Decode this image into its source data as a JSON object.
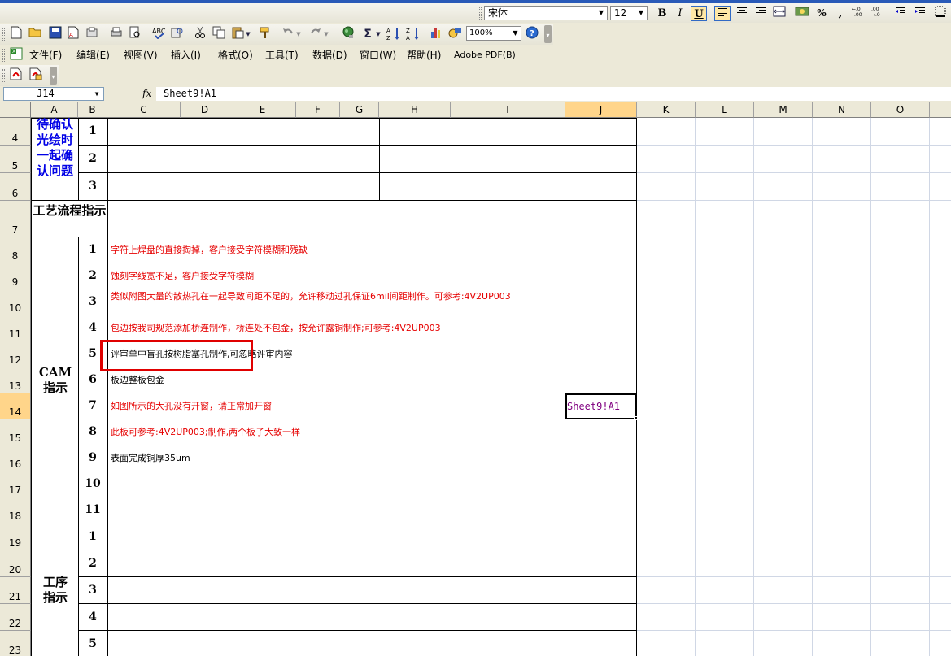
{
  "toolbar_format": {
    "font_name": "宋体",
    "font_size": "12",
    "bold_label": "B",
    "italic_label": "I",
    "underline_label": "U",
    "percent_label": "%",
    "comma_label": ","
  },
  "toolbar_standard": {
    "zoom": "100%"
  },
  "menu": {
    "items": [
      {
        "label": "文件(F)"
      },
      {
        "label": "编辑(E)"
      },
      {
        "label": "视图(V)"
      },
      {
        "label": "插入(I)"
      },
      {
        "label": "格式(O)"
      },
      {
        "label": "工具(T)"
      },
      {
        "label": "数据(D)"
      },
      {
        "label": "窗口(W)"
      },
      {
        "label": "帮助(H)"
      },
      {
        "label": "Adobe PDF(B)"
      }
    ]
  },
  "formula_bar": {
    "name_box": "J14",
    "fx_label": "fx",
    "formula": "Sheet9!A1"
  },
  "columns": [
    "A",
    "B",
    "C",
    "D",
    "E",
    "F",
    "G",
    "H",
    "I",
    "J",
    "K",
    "L",
    "M",
    "N",
    "O"
  ],
  "rows": [
    "4",
    "5",
    "6",
    "7",
    "8",
    "9",
    "10",
    "11",
    "12",
    "13",
    "14",
    "15",
    "16",
    "17",
    "18",
    "19",
    "20",
    "21",
    "22",
    "23"
  ],
  "sections": {
    "confirm": "待确认光绘时一起确认问题",
    "process": "工艺流程指示",
    "cam": "CAM指示",
    "procedure": "工序指示"
  },
  "confirm_items": [
    "1",
    "2",
    "3"
  ],
  "cam_items": [
    {
      "num": "1",
      "text": "字符上焊盘的直接掏掉，客户接受字符模糊和残缺",
      "color": "#e60000"
    },
    {
      "num": "2",
      "text": "蚀刻字线宽不足，客户接受字符模糊",
      "color": "#e60000"
    },
    {
      "num": "3",
      "text": "类似附图大量的散热孔在一起导致间距不足的，允许移动过孔保证6mil间距制作。可参考:4V2UP003",
      "color": "#e60000"
    },
    {
      "num": "4",
      "text": "包边按我司规范添加桥连制作，桥连处不包金，按允许露铜制作;可参考:4V2UP003",
      "color": "#e60000"
    },
    {
      "num": "5",
      "text": "评审单中盲孔按树脂塞孔制作,可忽略评审内容",
      "color": "#000000"
    },
    {
      "num": "6",
      "text": "板边整板包金",
      "color": "#000000"
    },
    {
      "num": "7",
      "text": "如图所示的大孔没有开窗，请正常加开窗",
      "color": "#e60000"
    },
    {
      "num": "8",
      "text": "此板可参考:4V2UP003;制作,两个板子大致一样",
      "color": "#e60000"
    },
    {
      "num": "9",
      "text": "表面完成铜厚35um",
      "color": "#000000"
    },
    {
      "num": "10",
      "text": "",
      "color": "#000000"
    },
    {
      "num": "11",
      "text": "",
      "color": "#000000"
    }
  ],
  "procedure_items": [
    "1",
    "2",
    "3",
    "4",
    "5"
  ],
  "active_cell": {
    "ref": "J14",
    "value": "Sheet9!A1"
  }
}
